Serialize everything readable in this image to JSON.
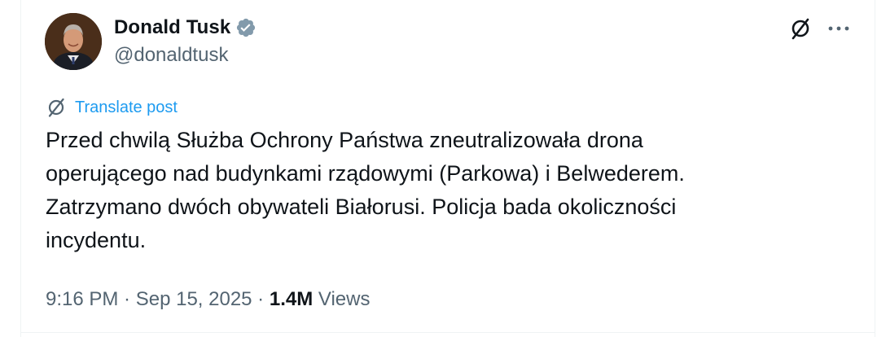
{
  "author": {
    "display_name": "Donald Tusk",
    "handle": "@donaldtusk",
    "verified": true,
    "avatar": "avatar-portrait"
  },
  "header_actions": {
    "grok_icon": "grok-icon",
    "more_icon": "more-horizontal-icon"
  },
  "translate": {
    "label": "Translate post",
    "icon": "globe-slash-icon"
  },
  "post": {
    "text": "Przed chwilą Służba Ochrony Państwa zneutralizowała drona\noperującego nad budynkami rządowymi (Parkowa) i Belwederem.\nZatrzymano dwóch obywateli Białorusi. Policja bada okoliczności\nincydentu."
  },
  "meta": {
    "time": "9:16 PM",
    "separator": " · ",
    "date": "Sep 15, 2025",
    "views_count": "1.4M",
    "views_label": " Views"
  },
  "colors": {
    "text_primary": "#0f1419",
    "text_secondary": "#536471",
    "accent_blue": "#1d9bf0",
    "verified_blue": "#829aab",
    "border": "#eff3f4"
  }
}
